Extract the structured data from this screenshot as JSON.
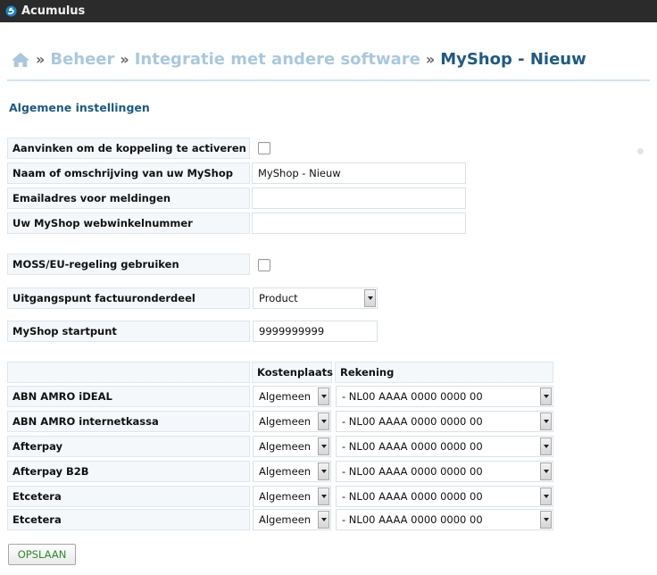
{
  "app": {
    "title": "Acumulus"
  },
  "breadcrumb": {
    "home_icon": "home-icon",
    "separator": "»",
    "items": [
      "Beheer",
      "Integratie met andere software"
    ],
    "current": "MyShop - Nieuw"
  },
  "section": {
    "title": "Algemene instellingen"
  },
  "fields": {
    "activate": {
      "label": "Aanvinken om de koppeling te activeren",
      "checked": false
    },
    "name": {
      "label": "Naam of omschrijving van uw MyShop",
      "value": "MyShop - Nieuw"
    },
    "email": {
      "label": "Emailadres voor meldingen",
      "value": ""
    },
    "shopnumber": {
      "label": "Uw MyShop webwinkelnummer",
      "value": ""
    },
    "moss": {
      "label": "MOSS/EU-regeling gebruiken",
      "checked": false
    },
    "invoice_basis": {
      "label": "Uitgangspunt factuuronderdeel",
      "value": "Product"
    },
    "startpoint": {
      "label": "MyShop startpunt",
      "value": "9999999999"
    }
  },
  "payment_table": {
    "headers": {
      "blank": "",
      "cost_center": "Kostenplaats",
      "account": "Rekening"
    },
    "rows": [
      {
        "name": "ABN AMRO iDEAL",
        "cost_center": "Algemeen",
        "account": "- NL00 AAAA 0000 0000 00"
      },
      {
        "name": "ABN AMRO internetkassa",
        "cost_center": "Algemeen",
        "account": "- NL00 AAAA 0000 0000 00"
      },
      {
        "name": "Afterpay",
        "cost_center": "Algemeen",
        "account": "- NL00 AAAA 0000 0000 00"
      },
      {
        "name": "Afterpay B2B",
        "cost_center": "Algemeen",
        "account": "- NL00 AAAA 0000 0000 00"
      },
      {
        "name": "Etcetera",
        "cost_center": "Algemeen",
        "account": "- NL00 AAAA 0000 0000 00"
      },
      {
        "name": "Etcetera",
        "cost_center": "Algemeen",
        "account": "- NL00 AAAA 0000 0000 00"
      }
    ]
  },
  "actions": {
    "save_label": "OPSLAAN"
  },
  "colors": {
    "topbar": "#2b2b2b",
    "breadcrumb_link": "#a9c8df",
    "breadcrumb_current": "#1f5a84",
    "section_title": "#1a5a86",
    "save_text": "#2f8a2f"
  }
}
